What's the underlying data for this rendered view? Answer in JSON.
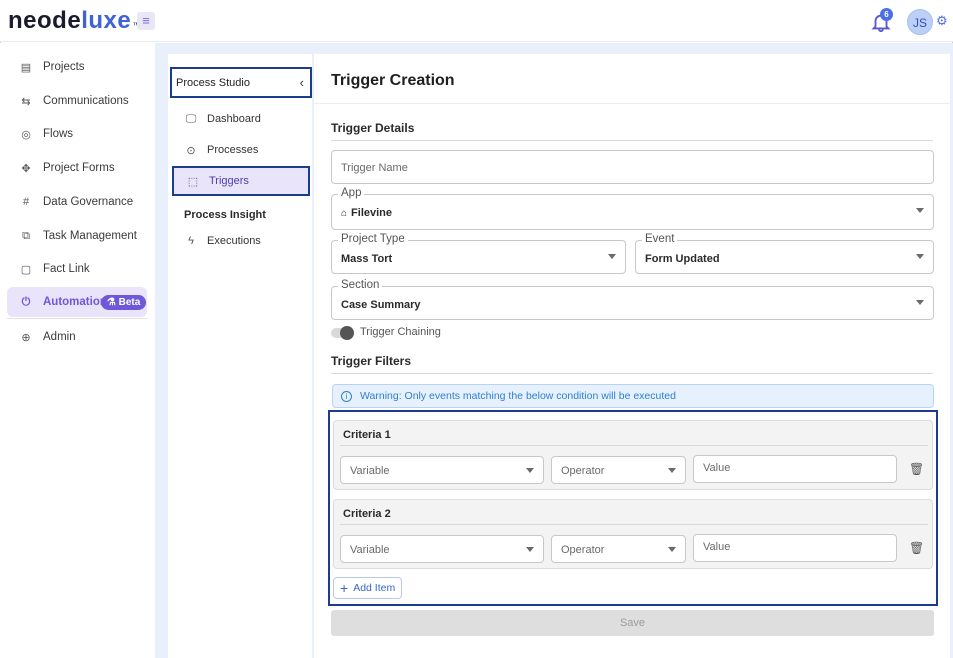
{
  "brand": {
    "logo_a": "neode",
    "logo_b": "luxe",
    "logo_tm": "™",
    "menu_icon": "hamburger-icon"
  },
  "header": {
    "notification_count": "6",
    "avatar_initials": "JS"
  },
  "sidebar": {
    "items": [
      {
        "label": "Projects",
        "icon": "clipboard-icon"
      },
      {
        "label": "Communications",
        "icon": "chat-icon"
      },
      {
        "label": "Flows",
        "icon": "flow-icon"
      },
      {
        "label": "Project Forms",
        "icon": "form-icon"
      },
      {
        "label": "Data Governance",
        "icon": "grid-icon"
      },
      {
        "label": "Task Management",
        "icon": "task-icon"
      },
      {
        "label": "Fact Link",
        "icon": "file-icon"
      },
      {
        "label": "Automation",
        "icon": "automation-icon",
        "badge": "Beta",
        "active": true
      },
      {
        "label": "Admin",
        "icon": "globe-icon"
      }
    ]
  },
  "subnav": {
    "header": "Process Studio",
    "items": [
      {
        "label": "Dashboard",
        "icon": "monitor-icon"
      },
      {
        "label": "Processes",
        "icon": "process-icon"
      },
      {
        "label": "Triggers",
        "icon": "trigger-icon",
        "active": true
      }
    ],
    "section": "Process Insight",
    "insight_items": [
      {
        "label": "Executions",
        "icon": "bolt-icon"
      }
    ]
  },
  "main": {
    "title": "Trigger Creation",
    "details_title": "Trigger Details",
    "trigger_name_placeholder": "Trigger Name",
    "app": {
      "label": "App",
      "value": "Filevine"
    },
    "project_type": {
      "label": "Project Type",
      "value": "Mass Tort"
    },
    "event": {
      "label": "Event",
      "value": "Form Updated"
    },
    "section": {
      "label": "Section",
      "value": "Case Summary"
    },
    "trigger_chaining_label": "Trigger Chaining",
    "filters_title": "Trigger Filters",
    "warning": "Warning: Only events matching the below condition will be executed",
    "criteria": [
      {
        "title": "Criteria 1",
        "variable": "Variable",
        "operator": "Operator",
        "value": "Value"
      },
      {
        "title": "Criteria 2",
        "variable": "Variable",
        "operator": "Operator",
        "value": "Value"
      }
    ],
    "add_item_label": "Add Item",
    "save_label": "Save"
  },
  "colors": {
    "accent": "#6c58d8",
    "highlight_border": "#1b3e8c",
    "info": "#2e7fd2",
    "content_bg": "#e9f0fb"
  }
}
